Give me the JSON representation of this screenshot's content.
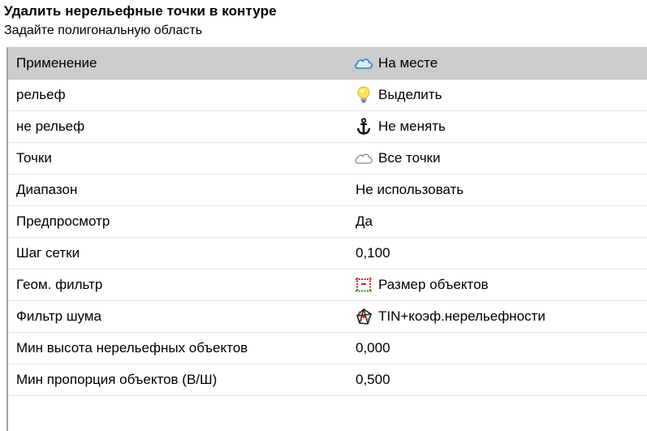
{
  "header": {
    "title": "Удалить нерельефные точки в контуре",
    "subtitle": "Задайте полигональную область"
  },
  "properties": [
    {
      "name": "Применение",
      "value": "На месте",
      "icon": "cloud-blue-icon",
      "selected": true
    },
    {
      "name": "рельеф",
      "value": "Выделить",
      "icon": "lightbulb-icon"
    },
    {
      "name": "не рельеф",
      "value": "Не менять",
      "icon": "anchor-icon"
    },
    {
      "name": "Точки",
      "value": "Все точки",
      "icon": "cloud-outline-icon"
    },
    {
      "name": "Диапазон",
      "value": "Не использовать",
      "icon": ""
    },
    {
      "name": "Предпросмотр",
      "value": "Да",
      "icon": ""
    },
    {
      "name": "Шаг сетки",
      "value": "0,100",
      "icon": ""
    },
    {
      "name": "Геом. фильтр",
      "value": "Размер объектов",
      "icon": "object-size-icon"
    },
    {
      "name": "Фильтр шума",
      "value": "TIN+коэф.нерельефности",
      "icon": "tin-noise-icon"
    },
    {
      "name": "Мин высота нерельефных объектов",
      "value": "0,000",
      "icon": ""
    },
    {
      "name": "Мин пропорция объектов (В/Ш)",
      "value": "0,500",
      "icon": ""
    }
  ]
}
